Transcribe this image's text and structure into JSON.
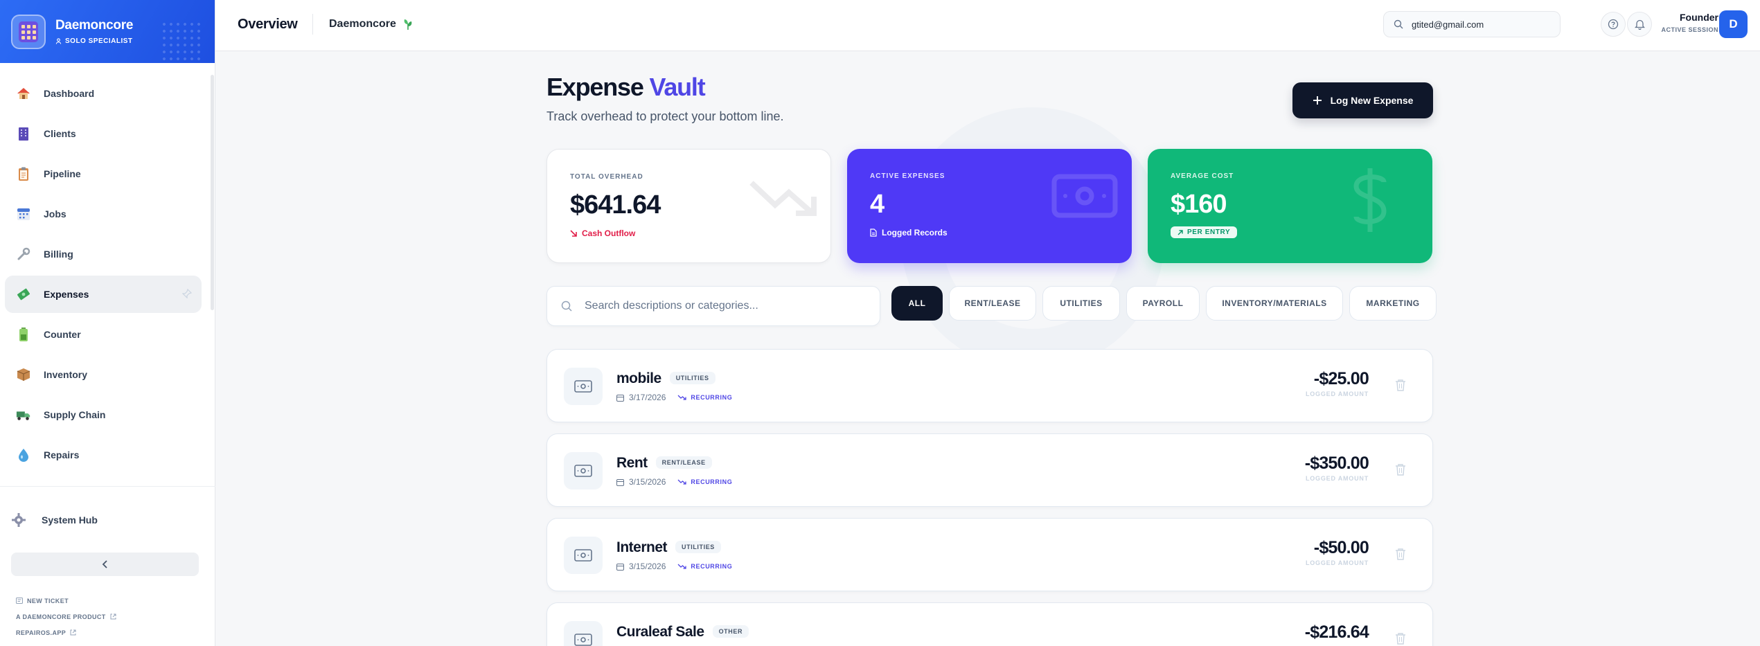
{
  "brand": {
    "name": "Daemoncore",
    "role": "SOLO SPECIALIST"
  },
  "nav": {
    "items": [
      {
        "label": "Dashboard",
        "icon": "house-icon"
      },
      {
        "label": "Clients",
        "icon": "building-icon"
      },
      {
        "label": "Pipeline",
        "icon": "clipboard-icon"
      },
      {
        "label": "Jobs",
        "icon": "calendar-icon"
      },
      {
        "label": "Billing",
        "icon": "wrench-icon"
      },
      {
        "label": "Expenses",
        "icon": "money-icon",
        "active": true
      },
      {
        "label": "Counter",
        "icon": "battery-icon"
      },
      {
        "label": "Inventory",
        "icon": "package-icon"
      },
      {
        "label": "Supply Chain",
        "icon": "truck-icon"
      },
      {
        "label": "Repairs",
        "icon": "droplet-icon"
      }
    ],
    "system_hub": "System Hub"
  },
  "footer_links": [
    "NEW TICKET",
    "A DAEMONCORE PRODUCT",
    "REPAIROS.APP"
  ],
  "topbar": {
    "title": "Overview",
    "subtitle": "Daemoncore",
    "search_value": "gtited@gmail.com",
    "user_name": "Founder",
    "user_status": "ACTIVE SESSION",
    "avatar_initial": "D"
  },
  "page": {
    "title_main": "Expense",
    "title_accent": "Vault",
    "subtitle": "Track overhead to protect your bottom line.",
    "log_button": "Log New Expense"
  },
  "stats": {
    "total": {
      "label": "TOTAL OVERHEAD",
      "value": "$641.64",
      "foot": "Cash Outflow"
    },
    "active": {
      "label": "ACTIVE EXPENSES",
      "value": "4",
      "foot": "Logged Records"
    },
    "average": {
      "label": "AVERAGE COST",
      "value": "$160",
      "foot": "PER ENTRY"
    }
  },
  "search": {
    "placeholder": "Search descriptions or categories..."
  },
  "filters": [
    "ALL",
    "RENT/LEASE",
    "UTILITIES",
    "PAYROLL",
    "INVENTORY/MATERIALS",
    "MARKETING"
  ],
  "expenses": [
    {
      "name": "mobile",
      "category": "UTILITIES",
      "date": "3/17/2026",
      "recurring": "RECURRING",
      "amount": "-$25.00",
      "amount_label": "LOGGED AMOUNT"
    },
    {
      "name": "Rent",
      "category": "RENT/LEASE",
      "date": "3/15/2026",
      "recurring": "RECURRING",
      "amount": "-$350.00",
      "amount_label": "LOGGED AMOUNT"
    },
    {
      "name": "Internet",
      "category": "UTILITIES",
      "date": "3/15/2026",
      "recurring": "RECURRING",
      "amount": "-$50.00",
      "amount_label": "LOGGED AMOUNT"
    },
    {
      "name": "Curaleaf Sale",
      "category": "OTHER",
      "amount": "-$216.64"
    }
  ],
  "colors": {
    "brand_blue": "#2563eb",
    "accent_purple": "#4f39f6",
    "accent_green": "#10b879",
    "outflow_red": "#e11d48",
    "dark": "#0f172a"
  }
}
